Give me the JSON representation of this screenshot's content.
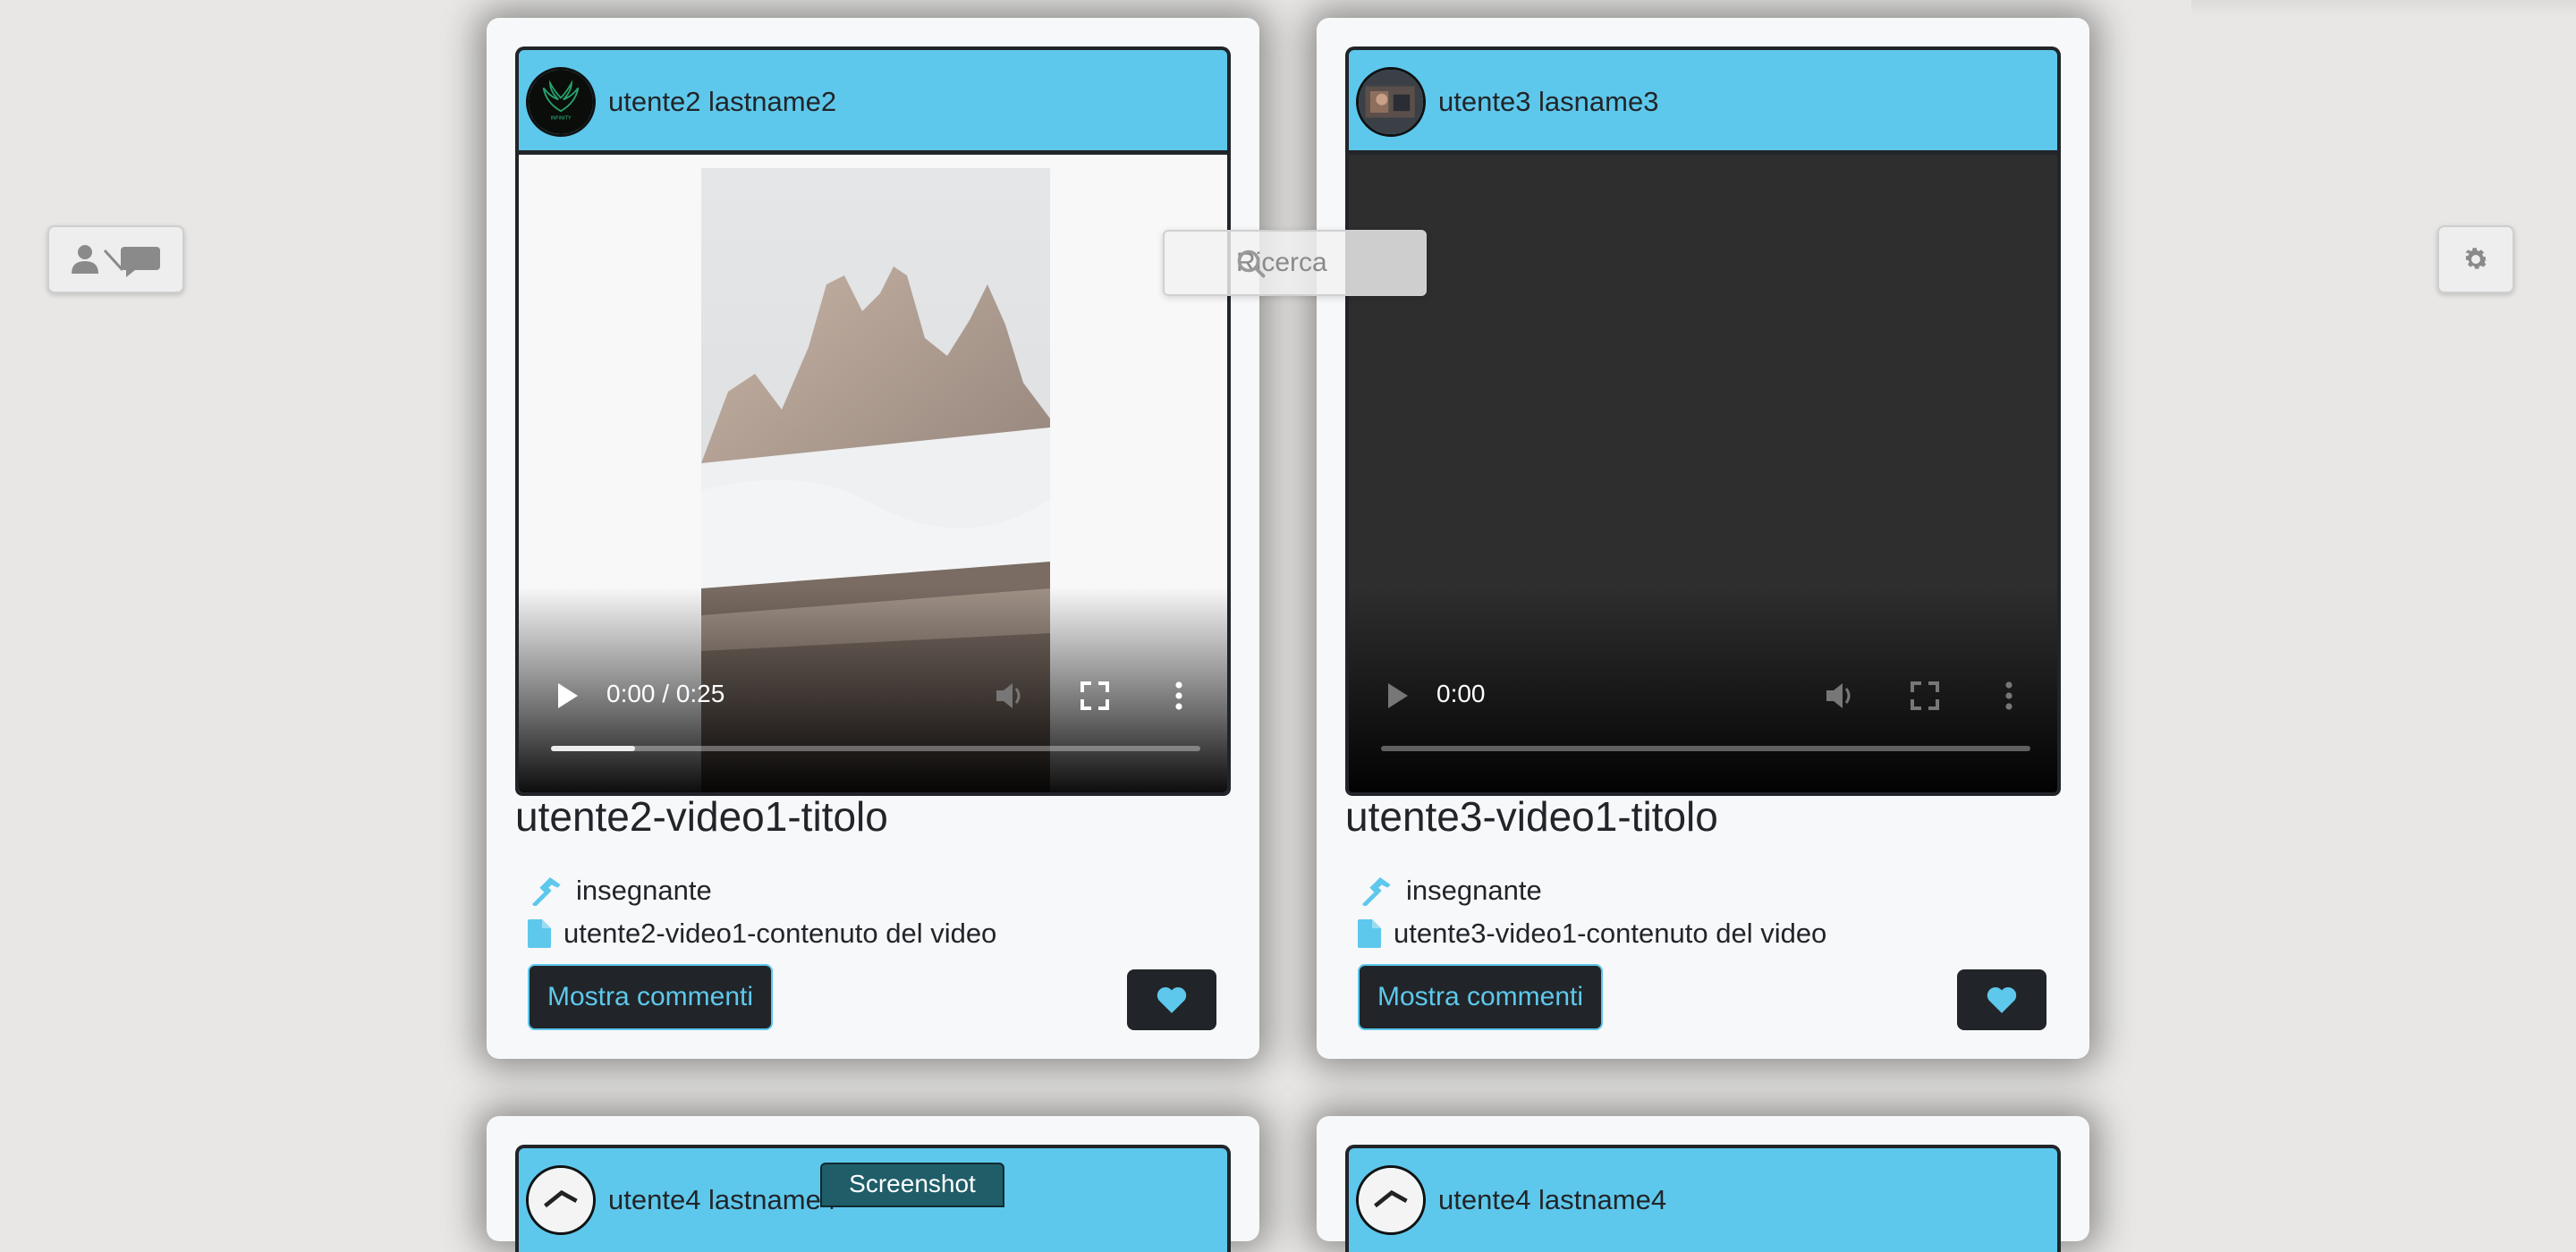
{
  "search": {
    "placeholder": "Ricerca",
    "icon": "search-icon"
  },
  "left_button": {
    "icons": [
      "user-icon",
      "slash-icon",
      "comment-icon"
    ]
  },
  "right_button": {
    "icon": "gear-icon"
  },
  "posts": [
    {
      "user": "utente2 lastname2",
      "video": {
        "time": "0:00 / 0:25",
        "progress": 0.13
      },
      "title": "utente2-video1-titolo",
      "role": "insegnante",
      "content": "utente2-video1-contenuto del video",
      "comments_label": "Mostra commenti"
    },
    {
      "user": "utente3 lasname3",
      "video": {
        "time": "0:00",
        "progress": 0
      },
      "title": "utente3-video1-titolo",
      "role": "insegnante",
      "content": "utente3-video1-contenuto del video",
      "comments_label": "Mostra commenti"
    },
    {
      "user": "utente4 lastname4"
    },
    {
      "user": "utente4 lastname4"
    }
  ],
  "screenshot_tab": "Screenshot",
  "colors": {
    "accent": "#5ec8ec",
    "dark": "#212529",
    "background": "#e8e7e5",
    "card": "#f7f8fa"
  }
}
